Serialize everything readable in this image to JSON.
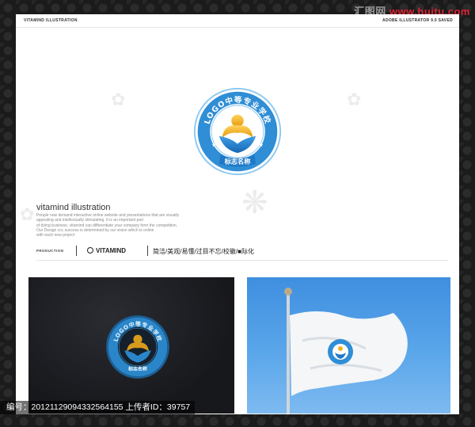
{
  "site_watermark": {
    "prefix": "汇图网",
    "domain": "www.huitu.com"
  },
  "header": {
    "left_label": "VITAMIND ILLUSTRATION",
    "right_label": "ADOBE ILLUSTRATOR 9.0 SAVED"
  },
  "logo": {
    "top_text": "LOGO中等专业学校",
    "banner_text": "标志名称",
    "colors": {
      "ring": "#2f8ed6",
      "ring_light": "#8ec9f0",
      "gold": "#f0b21c",
      "blue": "#1f79c8"
    }
  },
  "description": {
    "title": "vitamind illustration",
    "lines": [
      "People now demand interactive online website and presentations that are visually",
      "appealing and intellectually stimulating. It is an important part",
      "of doing business. vitamind can differentiate your company form the competition.",
      "Our Design ccc success is determined by our vision which is online",
      "with each new project"
    ]
  },
  "production": {
    "label": "PRODUCTION",
    "brand": "VITAMIND",
    "keywords": "简洁/美观/易懂/过目不忘/校徽/■际化"
  },
  "bottom_watermark": {
    "text": "编号：20121129094332564155 上传者ID：39757"
  }
}
